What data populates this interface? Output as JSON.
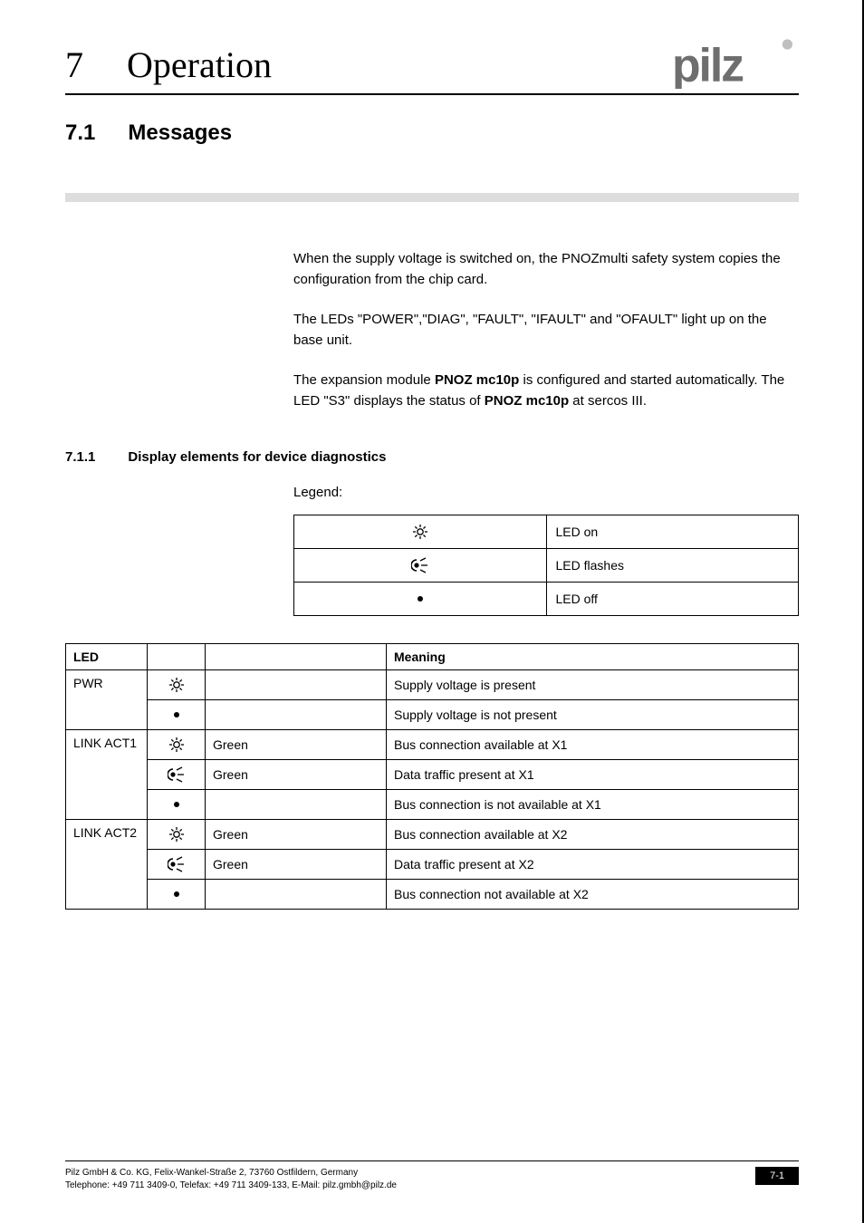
{
  "chapter": {
    "number": "7",
    "title": "Operation"
  },
  "section": {
    "number": "7.1",
    "title": "Messages"
  },
  "paragraphs": {
    "p1": "When the supply voltage is switched on, the PNOZmulti safety system copies the configuration from the chip card.",
    "p2": "The LEDs \"POWER\",\"DIAG\", \"FAULT\", \"IFAULT\" and \"OFAULT\" light up on the base unit.",
    "p3a": "The expansion module ",
    "p3b": "PNOZ mc10p",
    "p3c": " is configured and started automatically. The LED \"S3\" displays the status of ",
    "p3d": "PNOZ mc10p",
    "p3e": " at sercos III."
  },
  "subsection": {
    "number": "7.1.1",
    "title": "Display elements for device diagnostics"
  },
  "legend": {
    "label": "Legend:",
    "rows": [
      {
        "symbol": "led-on",
        "text": "LED on"
      },
      {
        "symbol": "led-flash",
        "text": "LED flashes"
      },
      {
        "symbol": "led-off",
        "text": "LED off"
      }
    ]
  },
  "table": {
    "headers": {
      "led": "LED",
      "meaning": "Meaning"
    },
    "groups": [
      {
        "led": "PWR",
        "rows": [
          {
            "symbol": "led-on",
            "color": "",
            "meaning": "Supply voltage is present"
          },
          {
            "symbol": "led-off",
            "color": "",
            "meaning": "Supply voltage is not present"
          }
        ]
      },
      {
        "led": "LINK ACT1",
        "rows": [
          {
            "symbol": "led-on",
            "color": "Green",
            "meaning": "Bus connection available at X1"
          },
          {
            "symbol": "led-flash",
            "color": "Green",
            "meaning": "Data traffic present at X1"
          },
          {
            "symbol": "led-off",
            "color": "",
            "meaning": "Bus connection is not available at X1"
          }
        ]
      },
      {
        "led": "LINK ACT2",
        "rows": [
          {
            "symbol": "led-on",
            "color": "Green",
            "meaning": "Bus connection available at X2"
          },
          {
            "symbol": "led-flash",
            "color": "Green",
            "meaning": "Data traffic present at X2"
          },
          {
            "symbol": "led-off",
            "color": "",
            "meaning": "Bus connection not available at X2"
          }
        ]
      }
    ]
  },
  "footer": {
    "line1": "Pilz GmbH & Co. KG, Felix-Wankel-Straße 2, 73760 Ostfildern, Germany",
    "line2": "Telephone: +49 711 3409-0, Telefax: +49 711 3409-133, E-Mail: pilz.gmbh@pilz.de",
    "page": "7-1"
  },
  "icons": {
    "led-on": "led-on-icon",
    "led-flash": "led-flash-icon",
    "led-off": "led-off-icon"
  },
  "brand": {
    "name": "pilz"
  }
}
